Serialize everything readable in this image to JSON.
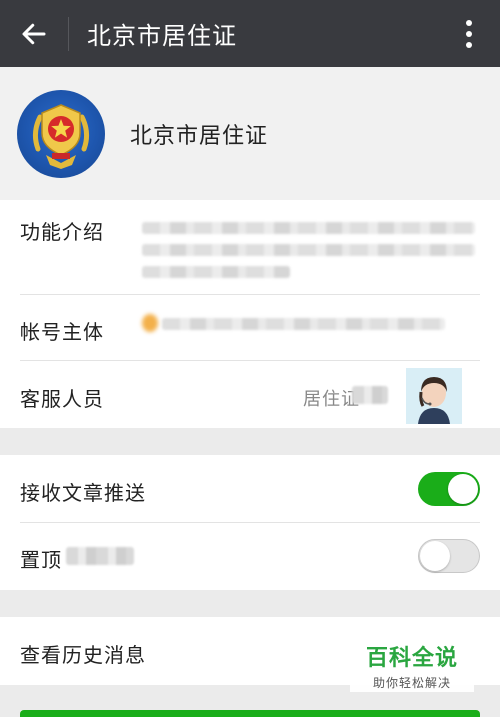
{
  "header": {
    "title": "北京市居住证",
    "back_icon": "arrow-left-icon",
    "more_icon": "more-vertical-icon"
  },
  "profile": {
    "name": "北京市居住证",
    "avatar_icon": "police-emblem-icon"
  },
  "info": {
    "intro_label": "功能介绍",
    "account_label": "帐号主体",
    "service_label": "客服人员",
    "service_value": "居住证"
  },
  "settings": {
    "receive_label": "接收文章推送",
    "receive_on": true,
    "pin_label": "置顶",
    "pin_on": false
  },
  "history": {
    "label": "查看历史消息"
  },
  "watermark": {
    "title": "百科全说",
    "subtitle": "助你轻松解决"
  },
  "colors": {
    "topbar": "#393a3f",
    "accent_green": "#1aad19",
    "watermark_green": "#2aa640"
  }
}
